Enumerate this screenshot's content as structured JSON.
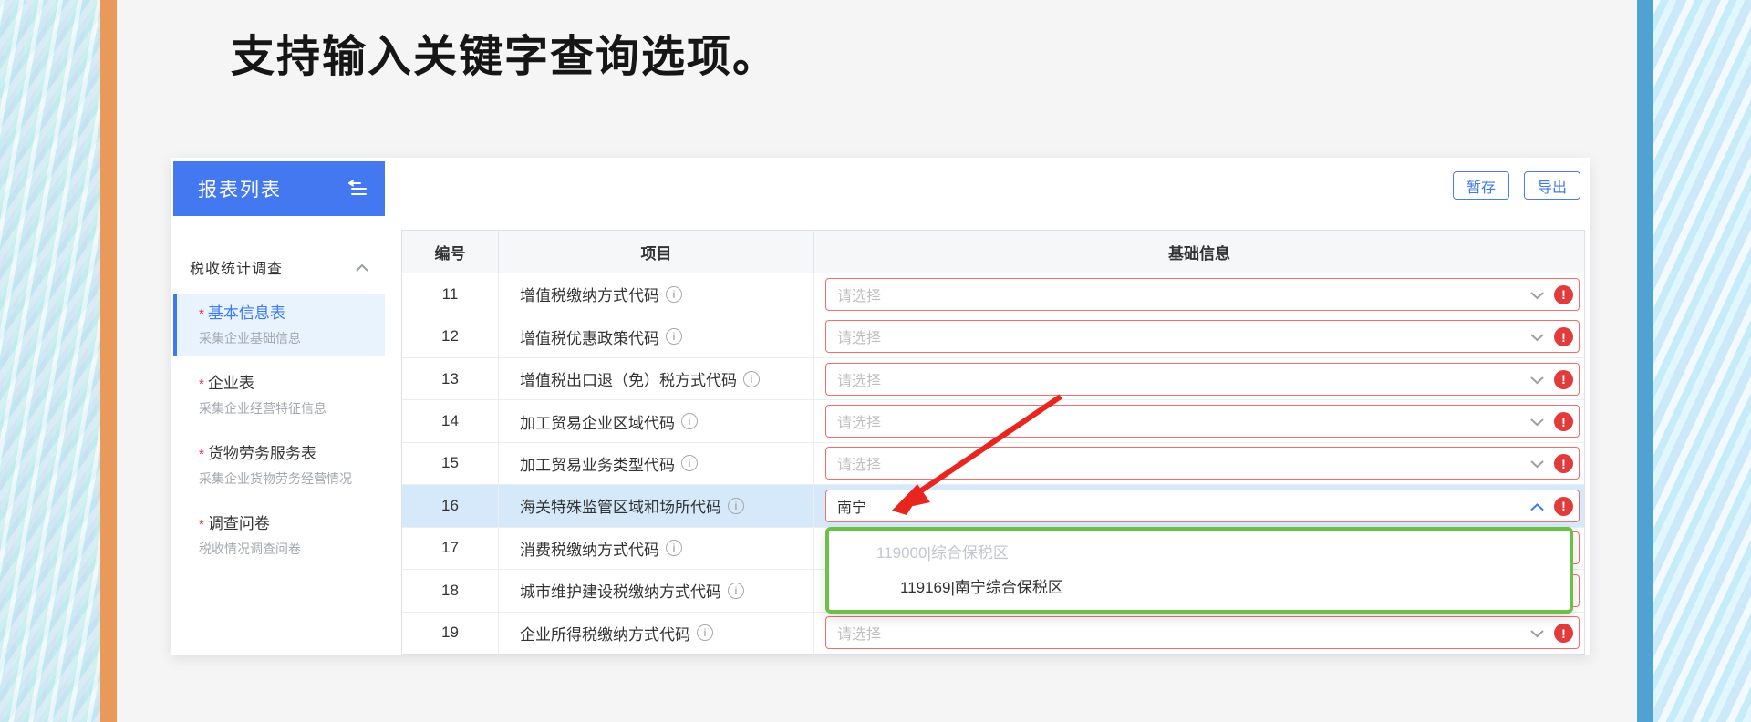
{
  "title": "支持输入关键字查询选项。",
  "sidebar": {
    "header": "报表列表",
    "section_label": "税收统计调查",
    "items": [
      {
        "required": "*",
        "label": "基本信息表",
        "desc": "采集企业基础信息",
        "active": true
      },
      {
        "required": "*",
        "label": "企业表",
        "desc": "采集企业经营特征信息",
        "active": false
      },
      {
        "required": "*",
        "label": "货物劳务服务表",
        "desc": "采集企业货物劳务经营情况",
        "active": false
      },
      {
        "required": "*",
        "label": "调查问卷",
        "desc": "税收情况调查问卷",
        "active": false
      }
    ]
  },
  "toolbar": {
    "save_label": "暂存",
    "export_label": "导出"
  },
  "table": {
    "columns": [
      "编号",
      "项目",
      "基础信息"
    ],
    "placeholder": "请选择",
    "rows": [
      {
        "no": "11",
        "item": "增值税缴纳方式代码",
        "value": "",
        "state": "error",
        "open": false,
        "highlight": false
      },
      {
        "no": "12",
        "item": "增值税优惠政策代码",
        "value": "",
        "state": "error",
        "open": false,
        "highlight": false
      },
      {
        "no": "13",
        "item": "增值税出口退（免）税方式代码",
        "value": "",
        "state": "error",
        "open": false,
        "highlight": false
      },
      {
        "no": "14",
        "item": "加工贸易企业区域代码",
        "value": "",
        "state": "error",
        "open": false,
        "highlight": false
      },
      {
        "no": "15",
        "item": "加工贸易业务类型代码",
        "value": "",
        "state": "error",
        "open": false,
        "highlight": false
      },
      {
        "no": "16",
        "item": "海关特殊监管区域和场所代码",
        "value": "南宁",
        "state": "error",
        "open": true,
        "highlight": true
      },
      {
        "no": "17",
        "item": "消费税缴纳方式代码",
        "value": "",
        "state": "error",
        "open": false,
        "highlight": false
      },
      {
        "no": "18",
        "item": "城市维护建设税缴纳方式代码",
        "value": "",
        "state": "error",
        "open": false,
        "highlight": false
      },
      {
        "no": "19",
        "item": "企业所得税缴纳方式代码",
        "value": "",
        "state": "error",
        "open": false,
        "highlight": false
      }
    ]
  },
  "dropdown": {
    "options": [
      {
        "text": "119000|综合保税区",
        "disabled": true
      },
      {
        "text": "119169|南宁综合保税区",
        "disabled": false
      }
    ]
  },
  "icons": {
    "info": "i",
    "error_badge": "!"
  },
  "colors": {
    "accent_blue": "#4478f1",
    "active_item_blue": "#3b7af0",
    "error_red": "#f56c6c",
    "badge_red": "#e23b3b",
    "success_green": "#6ebf45",
    "highlight_row": "#d5e9fa",
    "orange_strip": "#e99a5b",
    "blue_strip": "#4fa3d1",
    "annotation_arrow": "#e8251f"
  }
}
